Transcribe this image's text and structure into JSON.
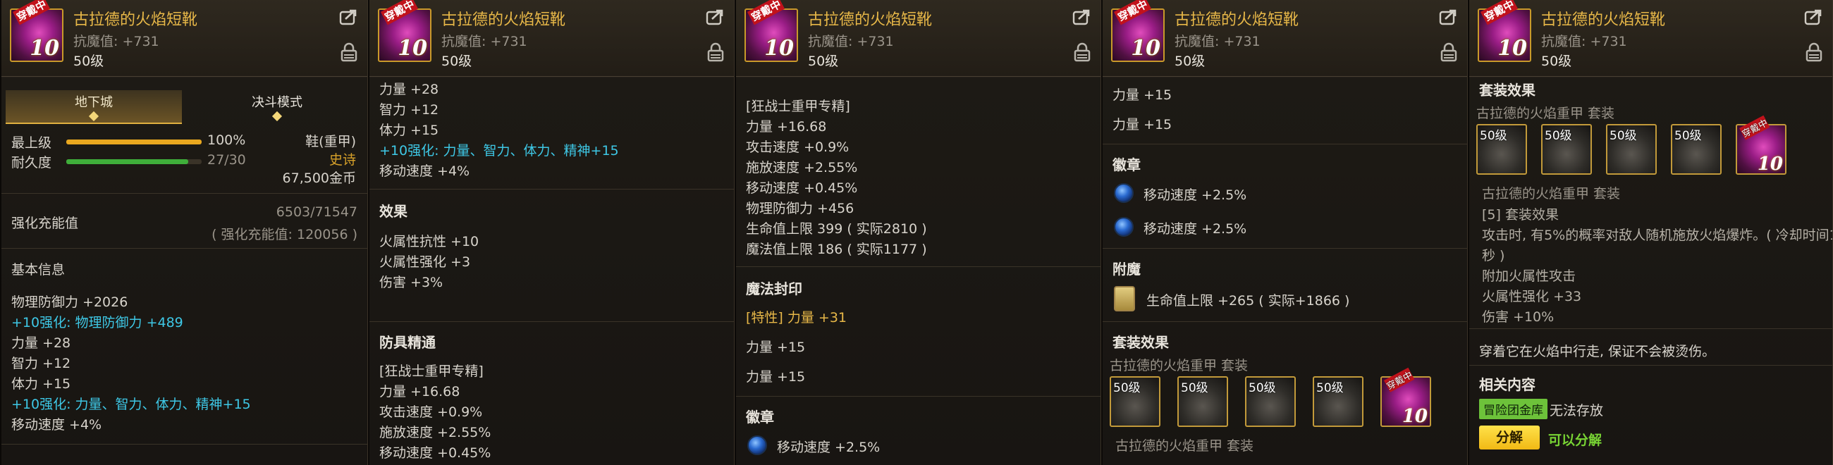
{
  "item": {
    "name": "古拉德的火焰短靴",
    "resist": "抗魔值: +731",
    "level": "50级",
    "wear_tag": "穿戴中",
    "enhance_badge": "10"
  },
  "panel1": {
    "tabs": [
      "地下城",
      "决斗模式"
    ],
    "bars": [
      {
        "label": "最上级",
        "value": "100%",
        "fill": 1.0,
        "color": "#e9a81f"
      },
      {
        "label": "耐久度",
        "value": "27/30",
        "fill": 0.9,
        "color": "#3fae3a"
      }
    ],
    "type": "鞋(重甲)",
    "rarity": "史诗",
    "price": "67,500金币",
    "charge_label": "强化充能值",
    "charge_value": "6503/71547",
    "charge_sub": "( 强化充能值: 120056 )",
    "basic_title": "基本信息",
    "stats": [
      {
        "text": "物理防御力 +2026",
        "cyan": false
      },
      {
        "text": "+10强化: 物理防御力 +489",
        "cyan": true
      },
      {
        "text": "力量 +28",
        "cyan": false
      },
      {
        "text": "智力 +12",
        "cyan": false
      },
      {
        "text": "体力 +15",
        "cyan": false
      },
      {
        "text": "+10强化: 力量、智力、体力、精神+15",
        "cyan": true
      },
      {
        "text": "移动速度 +4%",
        "cyan": false
      }
    ]
  },
  "panel2": {
    "stats": [
      {
        "text": "力量 +28",
        "cyan": false
      },
      {
        "text": "智力 +12",
        "cyan": false
      },
      {
        "text": "体力 +15",
        "cyan": false
      },
      {
        "text": "+10强化: 力量、智力、体力、精神+15",
        "cyan": true
      },
      {
        "text": "移动速度 +4%",
        "cyan": false
      }
    ],
    "effect_title": "效果",
    "effects": [
      "火属性抗性 +10",
      "火属性强化 +3",
      "伤害 +3%"
    ],
    "mastery_title": "防具精通",
    "mastery": [
      "[狂战士重甲专精]",
      "力量 +16.68",
      "攻击速度 +0.9%",
      "施放速度 +2.55%",
      "移动速度 +0.45%"
    ]
  },
  "panel3": {
    "mastery": [
      "[狂战士重甲专精]",
      "力量 +16.68",
      "攻击速度 +0.9%",
      "施放速度 +2.55%",
      "移动速度 +0.45%",
      "物理防御力 +456",
      "生命值上限 399 ( 实际2810 )",
      "魔法值上限 186 ( 实际1177 )"
    ],
    "seal_title": "魔法封印",
    "seal_special_tag": "[特性]",
    "seal_special_value": " 力量 +31",
    "seals": [
      "力量 +15",
      "力量 +15"
    ],
    "emblem_title": "徽章",
    "emblem": "移动速度 +2.5%"
  },
  "panel4": {
    "seals": [
      "力量 +15",
      "力量 +15"
    ],
    "emblem_title": "徽章",
    "emblems": [
      "移动速度 +2.5%",
      "移动速度 +2.5%"
    ],
    "enchant_title": "附魔",
    "enchant": "生命值上限 +265 ( 实际+1866 )",
    "set_title": "套装效果",
    "set_name": "古拉德的火焰重甲  套装",
    "slot_labels": [
      "50级",
      "50级",
      "50级",
      "50级"
    ],
    "set_name_bottom": "古拉德的火焰重甲  套装"
  },
  "panel5": {
    "set_title": "套装效果",
    "set_name": "古拉德的火焰重甲  套装",
    "slot_labels": [
      "50级",
      "50级",
      "50级",
      "50级"
    ],
    "set_name2": "古拉德的火焰重甲  套装",
    "set_lines": [
      "[5] 套装效果",
      "攻击时, 有5%的概率对敌人随机施放火焰爆炸。( 冷却时间1",
      "秒 )",
      "附加火属性攻击",
      "火属性强化 +33",
      "伤害 +10%"
    ],
    "flavor": "穿着它在火焰中行走, 保证不会被烫伤。",
    "related_title": "相关内容",
    "storage_badge": "冒险团金库",
    "storage_text": "无法存放",
    "decompose_button": "分解",
    "decompose_text": "可以分解"
  },
  "colors": {
    "gold": "#e8b848",
    "cyan": "#3ec8e6",
    "green": "#6dc23a"
  }
}
